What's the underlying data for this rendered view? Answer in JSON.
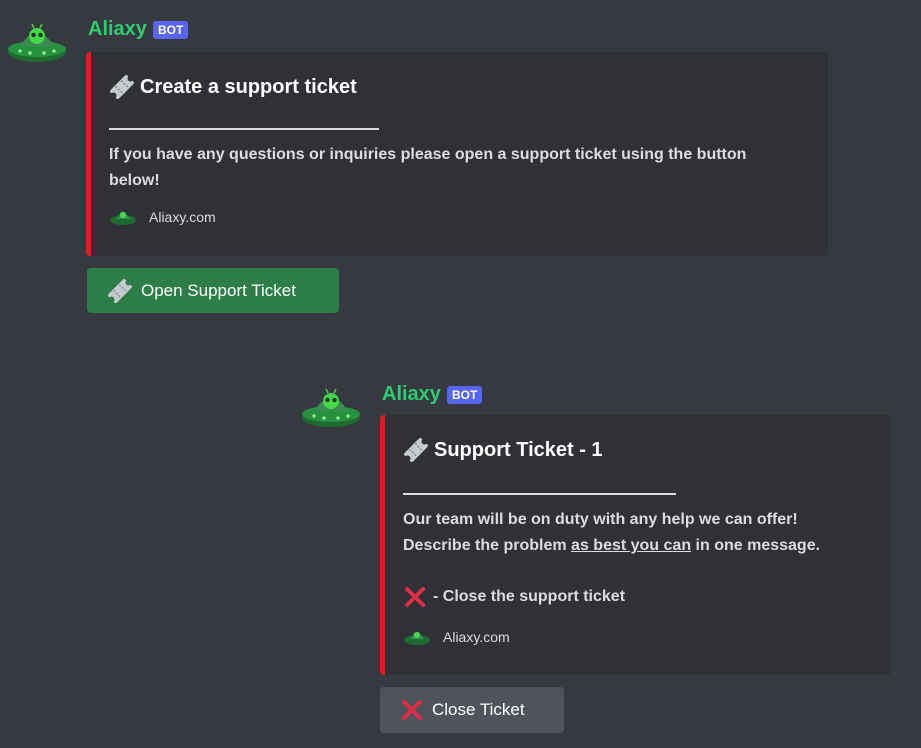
{
  "colors": {
    "background": "#36393f",
    "embed_bg": "#2f3136",
    "embed_accent": "#e01b24",
    "username": "#2ecc71",
    "bot_badge": "#5865f2",
    "open_button": "#2d7d46",
    "close_button": "#4f545c",
    "close_icon": "#dd2e44"
  },
  "messages": [
    {
      "author": "Aliaxy",
      "badge": "BOT",
      "avatar_icon": "ufo-alien-icon",
      "embed": {
        "title_icon": "ticket-icon",
        "title": "Create a support ticket",
        "description": "If you have any questions or inquiries please open a support ticket using the button below!",
        "footer_icon": "ufo-icon",
        "footer": "Aliaxy.com"
      },
      "button": {
        "icon": "ticket-icon",
        "label": "Open Support Ticket"
      }
    },
    {
      "author": "Aliaxy",
      "badge": "BOT",
      "avatar_icon": "ufo-alien-icon",
      "embed": {
        "title_icon": "ticket-icon",
        "title": "Support Ticket - 1",
        "description_line1": "Our team will be on duty with any help we can offer!",
        "description_line2_pre": "Describe the problem ",
        "description_line2_underlined": "as best you can",
        "description_line2_post": " in one message.",
        "close_icon": "cross-mark-icon",
        "close_text": "- Close the support ticket",
        "footer_icon": "ufo-icon",
        "footer": "Aliaxy.com"
      },
      "button": {
        "icon": "cross-mark-icon",
        "label": "Close Ticket"
      }
    }
  ]
}
